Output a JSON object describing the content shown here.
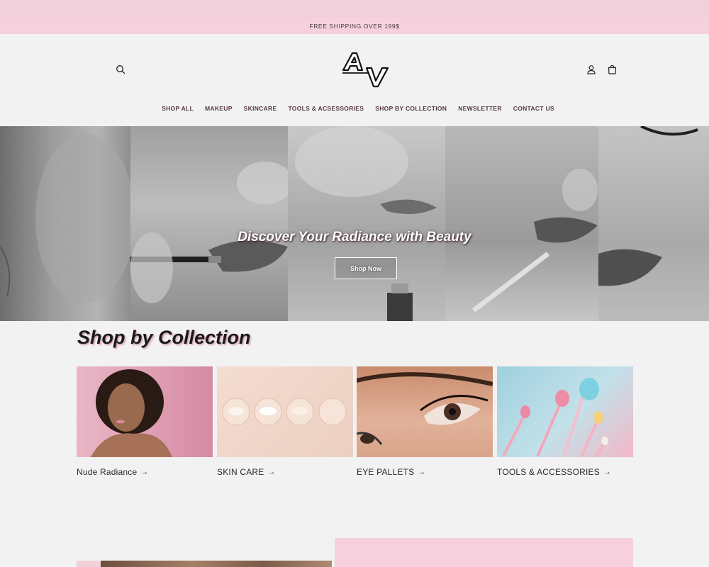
{
  "announcement": {
    "text": "FREE SHIPPING OVER 199$"
  },
  "header": {
    "logo_text": "AV",
    "icons": {
      "search": "search-icon",
      "account": "account-icon",
      "cart": "cart-icon"
    }
  },
  "nav": {
    "items": [
      {
        "label": "SHOP ALL"
      },
      {
        "label": "MAKEUP"
      },
      {
        "label": "SKINCARE"
      },
      {
        "label": "TOOLS & ACSESSORIES"
      },
      {
        "label": "SHOP BY COLLECTION"
      },
      {
        "label": "NEWSLETTER"
      },
      {
        "label": "CONTACT US"
      }
    ]
  },
  "hero": {
    "title": "Discover Your Radiance with Beauty",
    "button_label": "Shop Now"
  },
  "collections": {
    "title": "Shop by Collection",
    "items": [
      {
        "label": "Nude Radiance",
        "arrow": "→"
      },
      {
        "label": "SKIN CARE",
        "arrow": "→"
      },
      {
        "label": "EYE PALLETS",
        "arrow": "→"
      },
      {
        "label": "TOOLS & ACCESSORIES",
        "arrow": "→"
      }
    ]
  },
  "colors": {
    "announcement_bg": "#f6d1dd",
    "nav_text": "#553944",
    "page_bg": "#f2f2f2"
  }
}
